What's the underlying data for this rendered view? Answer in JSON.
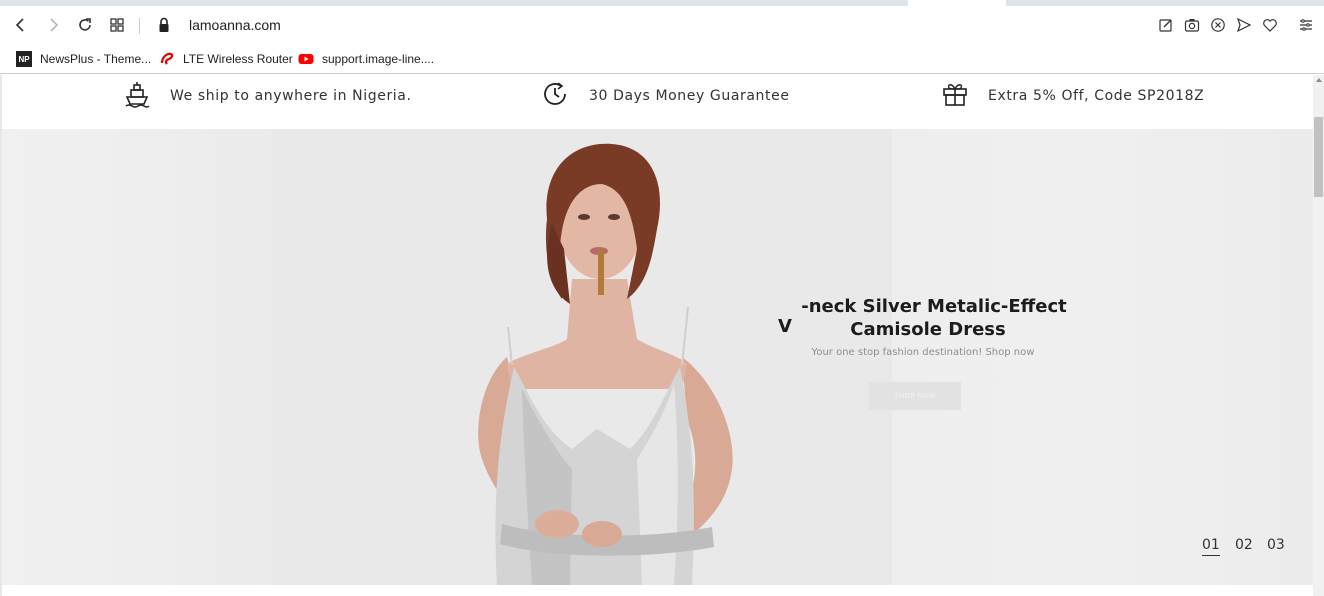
{
  "browser": {
    "url": "lamoanna.com",
    "nav_icons": [
      "back-icon",
      "forward-icon",
      "reload-icon",
      "tabs-grid-icon",
      "lock-icon"
    ],
    "right_icons": [
      "edit-icon",
      "camera-icon",
      "close-circle-icon",
      "send-icon",
      "heart-icon",
      "menu-icon"
    ]
  },
  "bookmarks": [
    {
      "label": "NewsPlus - Theme...",
      "icon": "np-icon"
    },
    {
      "label": "LTE Wireless Router",
      "icon": "airtel-icon"
    },
    {
      "label": "support.image-line....",
      "icon": "youtube-icon"
    }
  ],
  "info_strip": [
    {
      "text": "We ship to anywhere in Nigeria.",
      "icon": "ship-icon"
    },
    {
      "text": "30 Days Money Guarantee",
      "icon": "clock-icon"
    },
    {
      "text": "Extra 5% Off, Code SP2018Z",
      "icon": "gift-icon"
    }
  ],
  "hero": {
    "title_v": "V",
    "title_line1": "-neck Silver Metalic-Effect",
    "title_line2": "Camisole Dress",
    "subtitle": "Your one stop fashion destination! Shop now",
    "button": "SHOP NOW",
    "slides": [
      "01",
      "02",
      "03"
    ],
    "active_slide": "01"
  },
  "colors": {
    "text": "#333333",
    "hero_bg": "#eeeeee",
    "youtube_red": "#ff0000",
    "airtel_red": "#e40000"
  }
}
